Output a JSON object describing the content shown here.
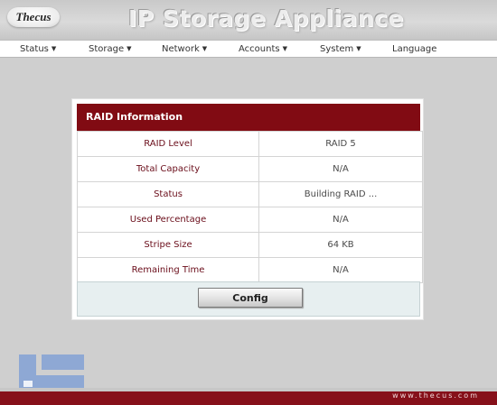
{
  "header": {
    "logo_text": "Thecus",
    "app_title": "IP Storage Appliance"
  },
  "nav": {
    "items": [
      {
        "label": "Status",
        "has_dropdown": true
      },
      {
        "label": "Storage",
        "has_dropdown": true
      },
      {
        "label": "Network",
        "has_dropdown": true
      },
      {
        "label": "Accounts",
        "has_dropdown": true
      },
      {
        "label": "System",
        "has_dropdown": true
      },
      {
        "label": "Language",
        "has_dropdown": false
      }
    ],
    "caret": "▼"
  },
  "raid_panel": {
    "title": "RAID Information",
    "rows": [
      {
        "label": "RAID Level",
        "value": "RAID 5"
      },
      {
        "label": "Total Capacity",
        "value": "N/A"
      },
      {
        "label": "Status",
        "value": "Building RAID ..."
      },
      {
        "label": "Used Percentage",
        "value": "N/A"
      },
      {
        "label": "Stripe Size",
        "value": "64 KB"
      },
      {
        "label": "Remaining Time",
        "value": "N/A"
      }
    ],
    "config_button": "Config"
  },
  "footer": {
    "url": "www.thecus.com"
  },
  "colors": {
    "accent": "#810b13",
    "label_text": "#6a0d1a",
    "background": "#cfcfcf",
    "config_area": "#e7eff0",
    "watermark_blue": "#86a3d4"
  }
}
